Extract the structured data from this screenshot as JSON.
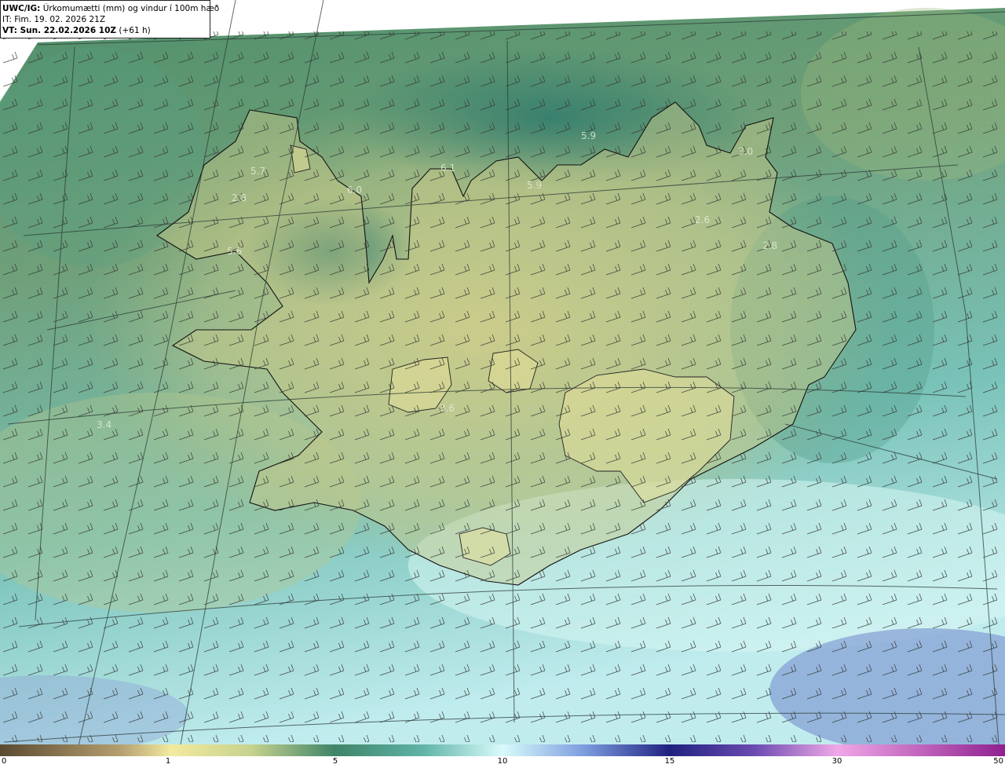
{
  "header": {
    "model_prefix": "UWC/IG:",
    "title": " Úrkomumætti (mm) og vindur í 100m hæð",
    "issue_time": "IT: Fim. 19. 02. 2026 21Z",
    "valid_prefix": "VT: Sun. 22.02.2026 10Z",
    "valid_suffix": " (+61 h)"
  },
  "value_labels": [
    "5.9",
    "3.0",
    "6.1",
    "5.9",
    "5.7",
    "6.0",
    "2.8",
    "2.6",
    "2.8",
    "5.6",
    "3.6",
    "3.4"
  ],
  "colorbar": {
    "ticks": [
      "0",
      "1",
      "5",
      "10",
      "15",
      "30",
      "50"
    ],
    "colors": [
      "#5a4a30",
      "#d8c79a",
      "#f2ea9e",
      "#3f8468",
      "#8fd4c8",
      "#d9fbfb",
      "#2f3f9e",
      "#1f2280",
      "#5a3fa0",
      "#f0a8e8",
      "#8f2090"
    ]
  }
}
